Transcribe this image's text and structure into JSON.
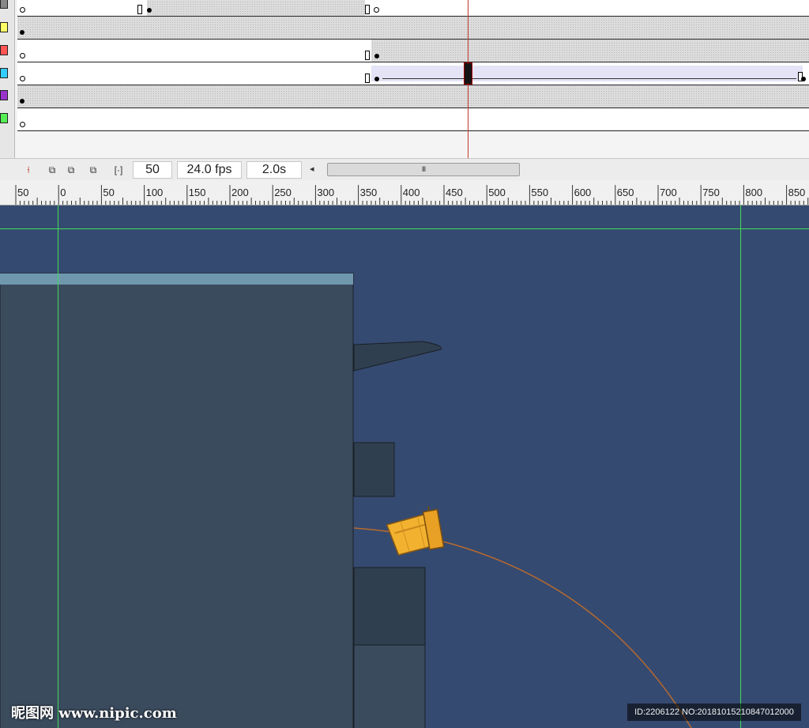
{
  "layers": {
    "colors": [
      "#888888",
      "#ffff66",
      "#ff5555",
      "#33ccff",
      "#9933cc",
      "#55ee55"
    ]
  },
  "statusbar": {
    "current_frame": "50",
    "frame_rate": "24.0 fps",
    "elapsed_time": "2.0s",
    "scrollbar_grip": "III"
  },
  "ruler": {
    "labels": [
      "50",
      "0",
      "50",
      "100",
      "150",
      "200",
      "250",
      "300",
      "350",
      "400",
      "450",
      "500",
      "550",
      "600",
      "650",
      "700",
      "750",
      "800",
      "850"
    ]
  },
  "stage": {
    "background_color": "#354a70",
    "guide_color": "#3fdc58"
  },
  "watermark": {
    "site": "昵图网 www.nipic.com",
    "id_text": "ID:2206122 NO:20181015210847012000"
  }
}
